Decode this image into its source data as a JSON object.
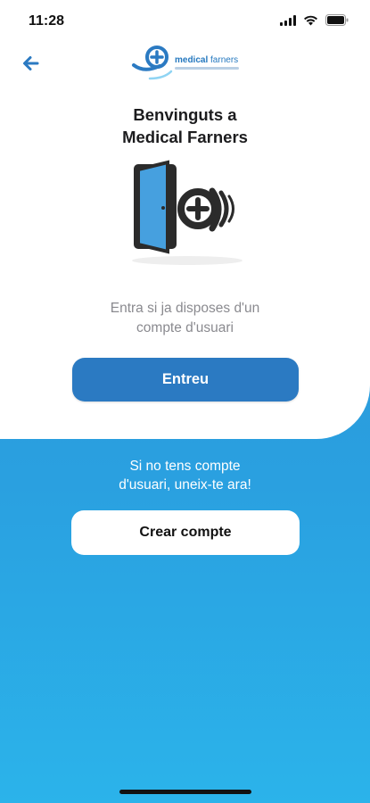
{
  "status_bar": {
    "time": "11:28"
  },
  "logo": {
    "word1": "medical",
    "word2": " farners"
  },
  "welcome": {
    "line1": "Benvinguts a",
    "line2": "Medical Farners"
  },
  "login": {
    "prompt_line1": "Entra si ja disposes d'un",
    "prompt_line2": "compte d'usuari",
    "button_label": "Entreu"
  },
  "signup": {
    "prompt_line1": "Si no tens compte",
    "prompt_line2": "d'usuari, uneix-te ara!",
    "button_label": "Crear compte"
  },
  "colors": {
    "primary": "#2b7ac2",
    "background_gradient_top": "#2f90d2",
    "background_gradient_bottom": "#2bb3ea"
  },
  "icons": [
    "back-arrow-icon",
    "signal-icon",
    "wifi-icon",
    "battery-icon",
    "door-entry-icon"
  ]
}
